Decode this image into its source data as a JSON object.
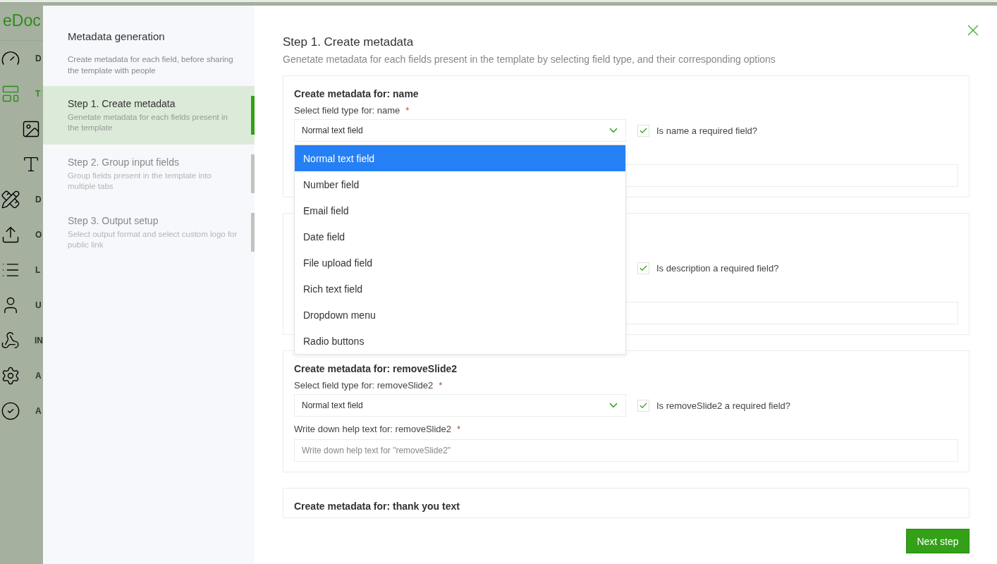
{
  "sidebar": {
    "logo": "eDoc",
    "items": [
      {
        "kind": "gauge",
        "label": "D",
        "selected": false
      },
      {
        "kind": "template",
        "label": "T",
        "selected": true,
        "children": [
          {
            "kind": "image"
          },
          {
            "kind": "text"
          }
        ]
      },
      {
        "kind": "draw",
        "label": "D",
        "selected": false
      },
      {
        "kind": "output",
        "label": "O",
        "selected": false
      },
      {
        "kind": "list",
        "label": "L",
        "selected": false
      },
      {
        "kind": "user",
        "label": "U",
        "selected": false
      },
      {
        "kind": "webhook",
        "label": "IN",
        "selected": false
      },
      {
        "kind": "automation",
        "label": "A",
        "selected": false
      },
      {
        "kind": "approval",
        "label": "A",
        "selected": false
      }
    ]
  },
  "steps_panel": {
    "title": "Metadata generation",
    "description": "Create metadata for each field, before sharing the template with people",
    "steps": [
      {
        "title": "Step 1. Create metadata",
        "description": "Genetate metadata for each fields present in the template",
        "selected": true
      },
      {
        "title": "Step 2. Group input fields",
        "description": "Group fields present in the template into multiple tabs",
        "selected": false
      },
      {
        "title": "Step 3. Output setup",
        "description": "Select output format and select custom logo for public link",
        "selected": false
      }
    ]
  },
  "main": {
    "title": "Step 1. Create metadata",
    "subtitle": "Genetate metadata for each fields present in the template by selecting field type, and their corresponding options",
    "cards": [
      {
        "kind": "field",
        "title": "Create metadata for: name",
        "select_label": "Select field type for: name",
        "select_mark": "*",
        "select_value": "Normal text field",
        "dropdown": {
          "open": true,
          "options": [
            {
              "label": "Normal text field",
              "selected": true
            },
            {
              "label": "Number field",
              "selected": false
            },
            {
              "label": "Email field",
              "selected": false
            },
            {
              "label": "Date field",
              "selected": false
            },
            {
              "label": "File upload field",
              "selected": false
            },
            {
              "label": "Rich text field",
              "selected": false
            },
            {
              "label": "Dropdown menu",
              "selected": false
            },
            {
              "label": "Radio buttons",
              "selected": false
            }
          ]
        },
        "required": {
          "label": "Is name a required field?",
          "checked": true
        }
      },
      {
        "kind": "field",
        "required": {
          "label": "Is description a required field?",
          "checked": true
        }
      },
      {
        "kind": "field",
        "title": "Create metadata for: removeSlide2",
        "select_label": "Select field type for: removeSlide2",
        "select_mark": "*",
        "select_value": "Normal text field",
        "required": {
          "label": "Is removeSlide2 a required field?",
          "checked": true
        },
        "help_label": "Write down help text for: removeSlide2",
        "help_mark": "*",
        "help_placeholder": "Write down help text for \"removeSlide2\""
      },
      {
        "kind": "collapsed",
        "title": "Create metadata for: thank you text"
      }
    ],
    "next_button": "Next step"
  }
}
